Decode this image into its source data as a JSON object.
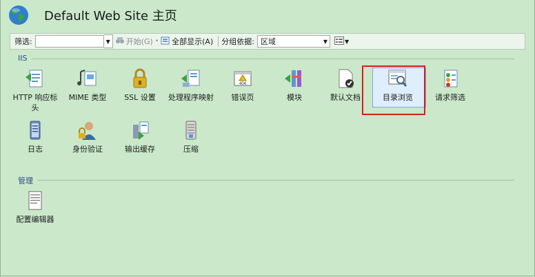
{
  "header": {
    "title": "Default Web Site 主页"
  },
  "toolbar": {
    "filter_label": "筛选:",
    "filter_value": "",
    "start_label": "开始(G)",
    "show_all_label": "全部显示(A)",
    "group_by_label": "分组依据:",
    "group_by_value": "区域"
  },
  "groups": {
    "iis": {
      "label": "IIS",
      "items": [
        {
          "label": "HTTP 响应标头",
          "icon": "http-response-headers-icon"
        },
        {
          "label": "MIME 类型",
          "icon": "mime-types-icon"
        },
        {
          "label": "SSL 设置",
          "icon": "ssl-lock-icon"
        },
        {
          "label": "处理程序映射",
          "icon": "handler-mappings-icon"
        },
        {
          "label": "错误页",
          "icon": "error-pages-404-icon"
        },
        {
          "label": "模块",
          "icon": "modules-icon"
        },
        {
          "label": "默认文档",
          "icon": "default-document-icon"
        },
        {
          "label": "目录浏览",
          "icon": "directory-browsing-icon",
          "selected": true
        },
        {
          "label": "请求筛选",
          "icon": "request-filtering-icon"
        },
        {
          "label": "日志",
          "icon": "logging-icon"
        },
        {
          "label": "身份验证",
          "icon": "authentication-icon"
        },
        {
          "label": "输出缓存",
          "icon": "output-caching-icon"
        },
        {
          "label": "压缩",
          "icon": "compression-icon"
        }
      ]
    },
    "management": {
      "label": "管理",
      "items": [
        {
          "label": "配置编辑器",
          "icon": "configuration-editor-icon"
        }
      ]
    }
  },
  "colors": {
    "background": "#cbe8cb",
    "highlight_border": "#d91c1c",
    "group_heading": "#2b4b8c"
  }
}
